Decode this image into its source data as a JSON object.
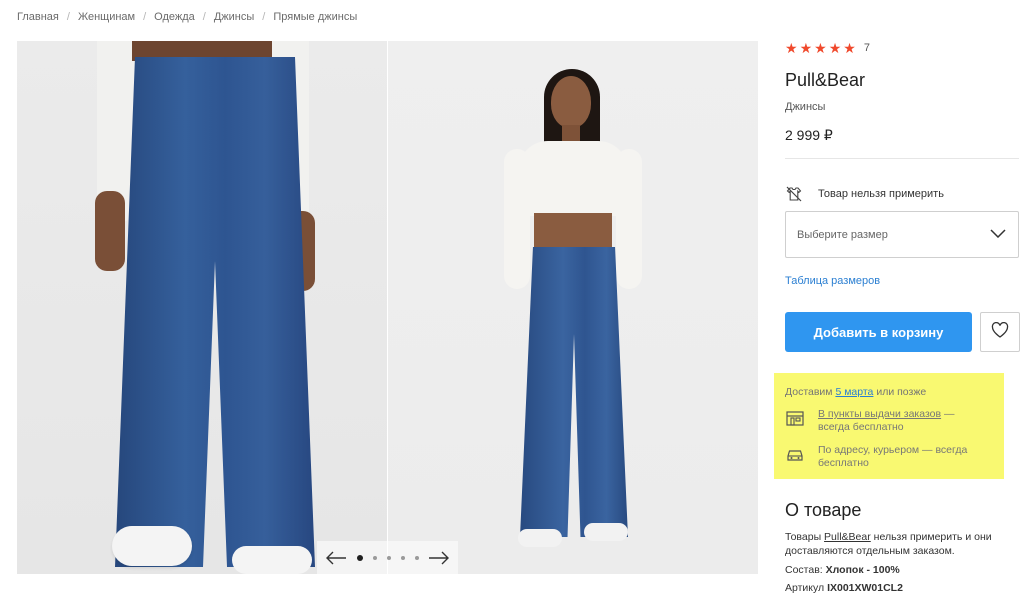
{
  "breadcrumb": {
    "items": [
      "Главная",
      "Женщинам",
      "Одежда",
      "Джинсы",
      "Прямые джинсы"
    ],
    "separator": "/"
  },
  "gallery": {
    "total_slides": 5,
    "active_slide": 1,
    "prev_icon": "arrow-left-icon",
    "next_icon": "arrow-right-icon"
  },
  "product": {
    "rating_stars": 5,
    "rating_count": "7",
    "brand": "Pull&Bear",
    "category": "Джинсы",
    "price": "2 999 ₽",
    "fitting_notice": "Товар нельзя примерить",
    "size_placeholder": "Выберите размер",
    "size_table_link": "Таблица размеров",
    "add_to_cart": "Добавить в корзину"
  },
  "delivery": {
    "prefix": "Доставим ",
    "date": "5 марта",
    "suffix": " или позже",
    "pickup_link": "В пункты выдачи заказов",
    "pickup_rest": " — всегда бесплатно",
    "courier_text": "По адресу, курьером — всегда бесплатно"
  },
  "about": {
    "title": "О товаре",
    "desc_prefix": "Товары ",
    "desc_brand": "Pull&Bear",
    "desc_suffix": " нельзя примерить и они доставляются отдельным заказом.",
    "composition_label": "Состав: ",
    "composition_value": "Хлопок - 100%",
    "sku_label": "Артикул ",
    "sku_value": "IX001XW01CL2"
  },
  "colors": {
    "accent_blue": "#2f96f0",
    "link_blue": "#2b7fd2",
    "star_red": "#f0492c",
    "highlight_yellow": "#f9f971"
  }
}
